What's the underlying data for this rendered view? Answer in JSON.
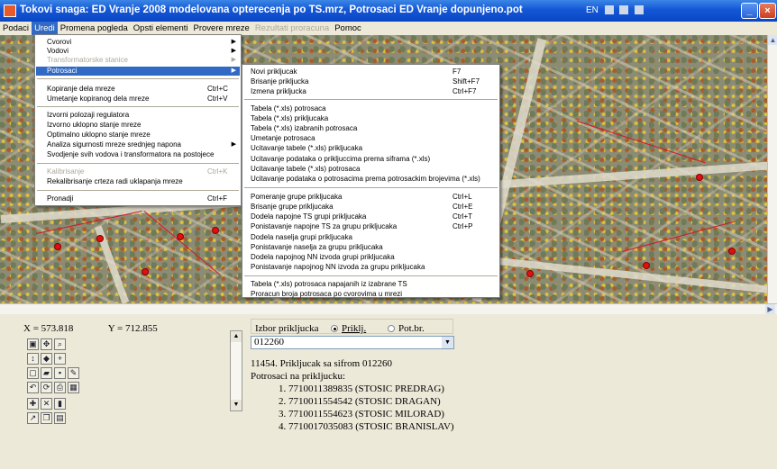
{
  "window": {
    "title": "Tokovi snaga: ED Vranje 2008 modelovana opterecenja po TS.mrz, Potrosaci ED Vranje dopunjeno.pot",
    "tray_lang": "EN",
    "minimize": "_",
    "close": "×"
  },
  "menubar": [
    "Podaci",
    "Uredi",
    "Promena pogleda",
    "Opsti elementi",
    "Provere mreze",
    "Rezultati proracuna",
    "Pomoc"
  ],
  "menu_uredi": {
    "items": [
      {
        "label": "Cvorovi",
        "shortcut": "",
        "submenu": true,
        "disabled": false
      },
      {
        "label": "Vodovi",
        "shortcut": "",
        "submenu": true,
        "disabled": false
      },
      {
        "label": "Transformatorske stanice",
        "shortcut": "",
        "submenu": true,
        "disabled": true
      },
      {
        "label": "Potrosaci",
        "shortcut": "",
        "submenu": true,
        "disabled": false
      },
      {
        "label": "Kopiranje dela mreze",
        "shortcut": "Ctrl+C",
        "submenu": false,
        "disabled": false
      },
      {
        "label": "Umetanje kopiranog dela mreze",
        "shortcut": "Ctrl+V",
        "submenu": false,
        "disabled": false
      },
      {
        "label": "Izvorni polozaji regulatora",
        "shortcut": "",
        "submenu": false,
        "disabled": false
      },
      {
        "label": "Izvorno uklopno stanje mreze",
        "shortcut": "",
        "submenu": false,
        "disabled": false
      },
      {
        "label": "Optimalno uklopno stanje mreze",
        "shortcut": "",
        "submenu": false,
        "disabled": false
      },
      {
        "label": "Analiza sigurnosti mreze srednjeg napona",
        "shortcut": "",
        "submenu": true,
        "disabled": false
      },
      {
        "label": "Svodjenje svih vodova i transformatora na postojece",
        "shortcut": "",
        "submenu": false,
        "disabled": false
      },
      {
        "label": "Kalibrisanje",
        "shortcut": "Ctrl+K",
        "submenu": false,
        "disabled": true
      },
      {
        "label": "Rekalibrisanje crteza radi uklapanja mreze",
        "shortcut": "",
        "submenu": false,
        "disabled": false
      },
      {
        "label": "Pronadji",
        "shortcut": "Ctrl+F",
        "submenu": false,
        "disabled": false
      }
    ]
  },
  "menu_potrosaci": {
    "items": [
      {
        "label": "Novi prikljucak",
        "shortcut": "F7"
      },
      {
        "label": "Brisanje prikljucka",
        "shortcut": "Shift+F7"
      },
      {
        "label": "Izmena prikljucka",
        "shortcut": "Ctrl+F7"
      },
      {
        "label": "Tabela (*.xls) potrosaca",
        "shortcut": ""
      },
      {
        "label": "Tabela (*.xls) prikljucaka",
        "shortcut": ""
      },
      {
        "label": "Tabela (*.xls) izabranih potrosaca",
        "shortcut": ""
      },
      {
        "label": "Umetanje potrosaca",
        "shortcut": ""
      },
      {
        "label": "Ucitavanje tabele (*.xls) prikljucaka",
        "shortcut": ""
      },
      {
        "label": "Ucitavanje podataka o prikljuccima prema siframa (*.xls)",
        "shortcut": ""
      },
      {
        "label": "Ucitavanje tabele (*.xls) potrosaca",
        "shortcut": ""
      },
      {
        "label": "Ucitavanje podataka o potrosacima prema potrosackim brojevima (*.xls)",
        "shortcut": ""
      },
      {
        "label": "Pomeranje grupe prikljucaka",
        "shortcut": "Ctrl+L"
      },
      {
        "label": "Brisanje grupe prikljucaka",
        "shortcut": "Ctrl+E"
      },
      {
        "label": "Dodela napojne TS grupi prikljucaka",
        "shortcut": "Ctrl+T"
      },
      {
        "label": "Ponistavanje napojne TS za grupu prikljucaka",
        "shortcut": "Ctrl+P"
      },
      {
        "label": "Dodela naselja grupi prikljucaka",
        "shortcut": ""
      },
      {
        "label": "Ponistavanje naselja za grupu prikljucaka",
        "shortcut": ""
      },
      {
        "label": "Dodela napojnog NN izvoda grupi prikljucaka",
        "shortcut": ""
      },
      {
        "label": "Ponistavanje napojnog NN izvoda za grupu prikljucaka",
        "shortcut": ""
      },
      {
        "label": "Tabela (*.xls) potrosaca napajanih iz izabrane TS",
        "shortcut": ""
      },
      {
        "label": "Proracun broja potrosaca po cvorovima u mrezi",
        "shortcut": ""
      }
    ]
  },
  "coords": {
    "x": "X = 573.818",
    "y": "Y = 712.855"
  },
  "search": {
    "label": "Izbor prikljucka",
    "option1": "Priklj.",
    "option2": "Pot.br.",
    "value": "012260"
  },
  "result": {
    "header": "11454. Prikljucak sa sifrom 012260",
    "subheader": "Potrosaci na prikljucku:",
    "lines": [
      "1. 7710011389835 (STOSIC PREDRAG)",
      "2. 7710011554542 (STOSIC DRAGAN)",
      "3. 7710011554623 (STOSIC MILORAD)",
      "4. 7710017035083 (STOSIC BRANISLAV)"
    ]
  }
}
